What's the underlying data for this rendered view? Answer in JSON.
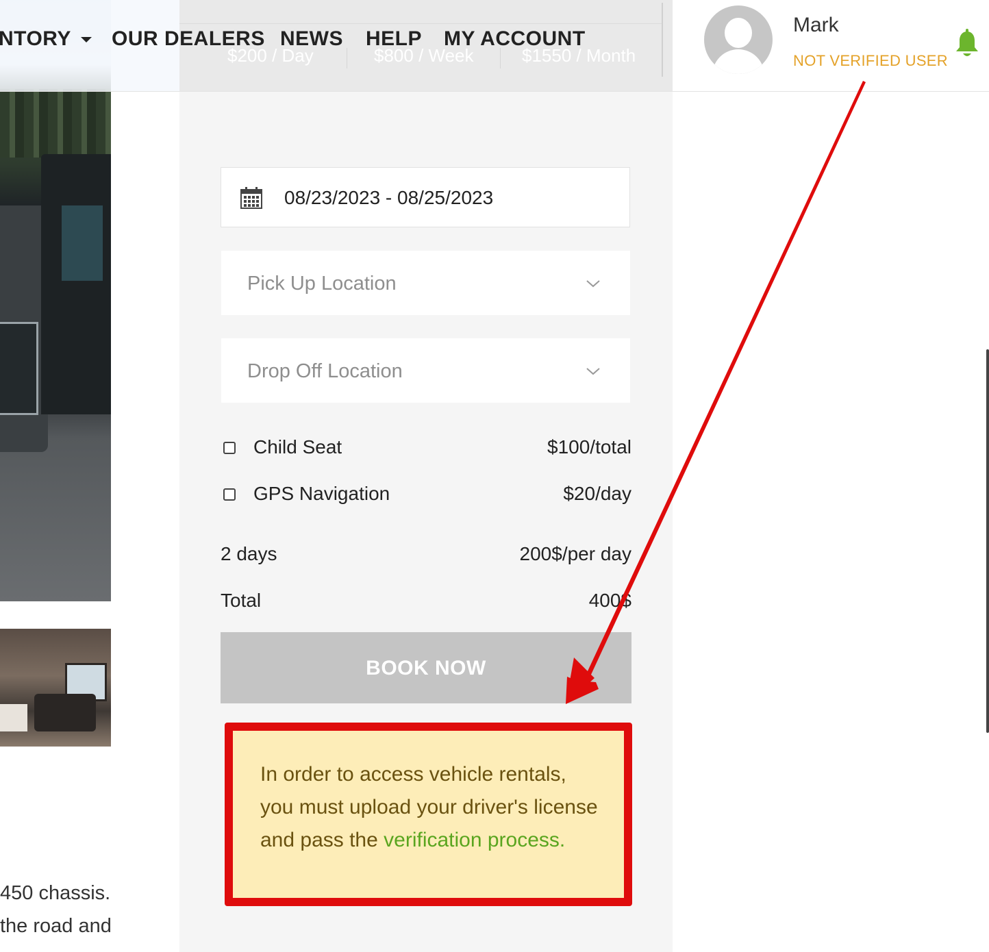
{
  "nav": {
    "items": [
      "NTORY",
      "OUR DEALERS",
      "NEWS",
      "HELP",
      "MY ACCOUNT"
    ]
  },
  "pricing": {
    "day": "$200 / Day",
    "week": "$800 / Week",
    "month": "$1550 / Month"
  },
  "user": {
    "name": "Mark",
    "status": "NOT VERIFIED USER"
  },
  "booking": {
    "date_range": "08/23/2023 - 08/25/2023",
    "pickup_placeholder": "Pick Up Location",
    "dropoff_placeholder": "Drop Off Location",
    "options": [
      {
        "label": "Child Seat",
        "price": "$100/total"
      },
      {
        "label": "GPS Navigation",
        "price": "$20/day"
      }
    ],
    "duration_label": "2 days",
    "duration_rate": "200$/per day",
    "total_label": "Total",
    "total_value": "400$",
    "book_button": "BOOK NOW"
  },
  "notice": {
    "text": "In order to access vehicle rentals, you must upload your driver's license and pass the ",
    "link": "verification process."
  },
  "description": {
    "line1": "450 chassis.",
    "line2": "the road and"
  },
  "colors": {
    "status": "#e4a229",
    "bell": "#6cb52d",
    "annotation": "#df0c0c",
    "notice_bg": "#fdedb8",
    "link": "#5aa51f"
  }
}
